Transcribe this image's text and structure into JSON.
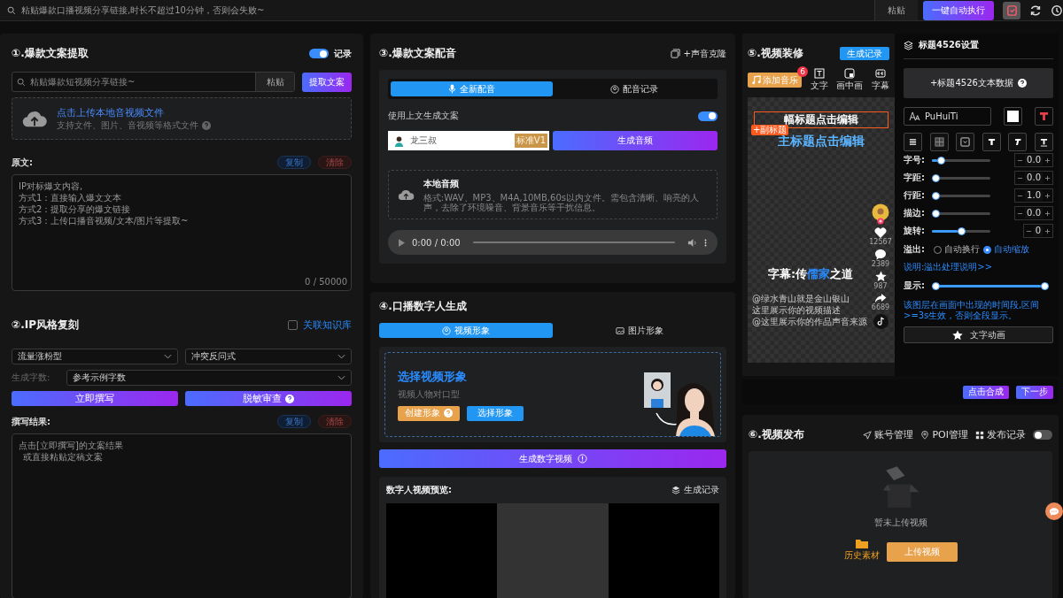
{
  "top_bar": {
    "search_placeholder": "粘贴爆款口播视频分享链接,时长不超过10分钟，否则会失败~",
    "paste_button": "粘贴",
    "run_button": "一键自动执行"
  },
  "section1": {
    "title": "①.爆款文案提取",
    "record_toggle": {
      "label": "记录",
      "on": true
    },
    "link_placeholder": "粘贴爆款短视频分享链接~",
    "paste_button": "粘贴",
    "extract_button": "提取文案",
    "upload": {
      "title": "点击上传本地音视频文件",
      "hint": "支持文件、图片、音视频等格式文件"
    },
    "source_label": "原文:",
    "copy_button": "复制",
    "clear_button": "清除",
    "source_placeholder": [
      "IP对标爆文内容,",
      "方式1：直接输入爆文文本",
      "方式2：提取分享的爆文链接",
      "方式3：上传口播音视频/文本/图片等提取~"
    ],
    "counter": "0 / 50000"
  },
  "section2": {
    "title": "②.IP风格复刻",
    "knowledge": {
      "label": "关联知识库",
      "checked": false
    },
    "selects": [
      "流量涨粉型",
      "冲突反问式"
    ],
    "word_count_label": "生成字数:",
    "word_count_value": "参考示例字数",
    "write_button": "立即撰写",
    "review_button": "脱敏审查",
    "result_label": "撰写结果:",
    "copy_button": "复制",
    "clear_button": "清除",
    "result_placeholder": [
      "点击[立即撰写]的文案结果",
      "或直接粘贴定稿文案"
    ]
  },
  "section3": {
    "title": "③.爆款文案配音",
    "clone_button": "+声音克隆",
    "tabs": [
      {
        "label": "全新配音",
        "selected": true
      },
      {
        "label": "配音记录",
        "selected": false
      }
    ],
    "use_above": {
      "label": "使用上文生成文案",
      "on": true
    },
    "voice": {
      "name": "龙三叔",
      "badge": "标准V1"
    },
    "generate_button": "生成音频",
    "local_audio": {
      "title": "本地音频",
      "hint": "格式:WAV、MP3、M4A,10MB,60s以内文件。需包含清晰、响亮的人声，去除了环境噪音、背景音乐等干扰信息。"
    },
    "player_time": "0:00 / 0:00"
  },
  "section4": {
    "title": "④.口播数字人生成",
    "tabs": [
      {
        "label": "视频形象",
        "selected": true
      },
      {
        "label": "图片形象",
        "selected": false
      }
    ],
    "avatar": {
      "title": "选择视频形象",
      "subtitle": "视频人物对口型",
      "create_button": "创建形象",
      "select_button": "选择形象"
    },
    "generate_button": "生成数字视频",
    "preview_label": "数字人视频预览:",
    "record_button": "生成记录"
  },
  "section5": {
    "title": "⑤.视频装修",
    "record_button": "生成记录",
    "music_button": {
      "label": "添加音乐",
      "badge": "6"
    },
    "tools": [
      {
        "kind": "text",
        "label": "文字"
      },
      {
        "kind": "pip",
        "label": "画中画"
      },
      {
        "kind": "subtitle",
        "label": "字幕"
      }
    ],
    "canvas": {
      "heading": "幅标题点击编辑",
      "subtitle_tag": "+副标题",
      "main_title": "主标题点击编辑",
      "caption": [
        {
          "text": "字幕:传",
          "highlight": false
        },
        {
          "text": "儒家",
          "highlight": true
        },
        {
          "text": "之道",
          "highlight": false
        }
      ],
      "stats": [
        {
          "kind": "heart",
          "count": "12567"
        },
        {
          "kind": "comment",
          "count": "2389"
        },
        {
          "kind": "star",
          "count": "987"
        },
        {
          "kind": "share",
          "count": "6689"
        }
      ],
      "description": [
        "@绿水青山就是金山银山",
        "这里展示你的视频描述",
        "@这里展示你的作品声音来源"
      ]
    },
    "settings": {
      "title": "标题4526设置",
      "data_button": "+标题4526文本数据",
      "font": "PuHuiTi",
      "sliders": [
        {
          "label": "字号:",
          "level": 0.1,
          "value": "0.0"
        },
        {
          "label": "字距:",
          "level": 0,
          "value": "0.0"
        },
        {
          "label": "行距:",
          "level": 0,
          "value": "1.0"
        },
        {
          "label": "描边:",
          "level": 0,
          "value": "0.0"
        },
        {
          "label": "旋转:",
          "level": 0.5,
          "value": "0"
        }
      ],
      "overflow": {
        "label": "溢出:",
        "options": [
          {
            "label": "自动换行",
            "selected": false
          },
          {
            "label": "自动缩放",
            "selected": true
          }
        ]
      },
      "note_link": "说明:溢出处理说明>>",
      "display": {
        "label": "显示:",
        "level": 1
      },
      "display_note": "该图层在画面中出现的时间段,区间>=3s生效，否则全段显示。",
      "animation_button": "文字动画"
    },
    "actions": [
      "点击合成",
      "下一步"
    ]
  },
  "section6": {
    "title": "⑥.视频发布",
    "links": [
      {
        "kind": "account",
        "label": "账号管理"
      },
      {
        "kind": "poi",
        "label": "POI管理"
      },
      {
        "kind": "records",
        "label": "发布记录"
      }
    ],
    "toggle_on": false,
    "empty": "暂未上传视频",
    "history": "历史素材",
    "upload_button": "上传视频"
  }
}
